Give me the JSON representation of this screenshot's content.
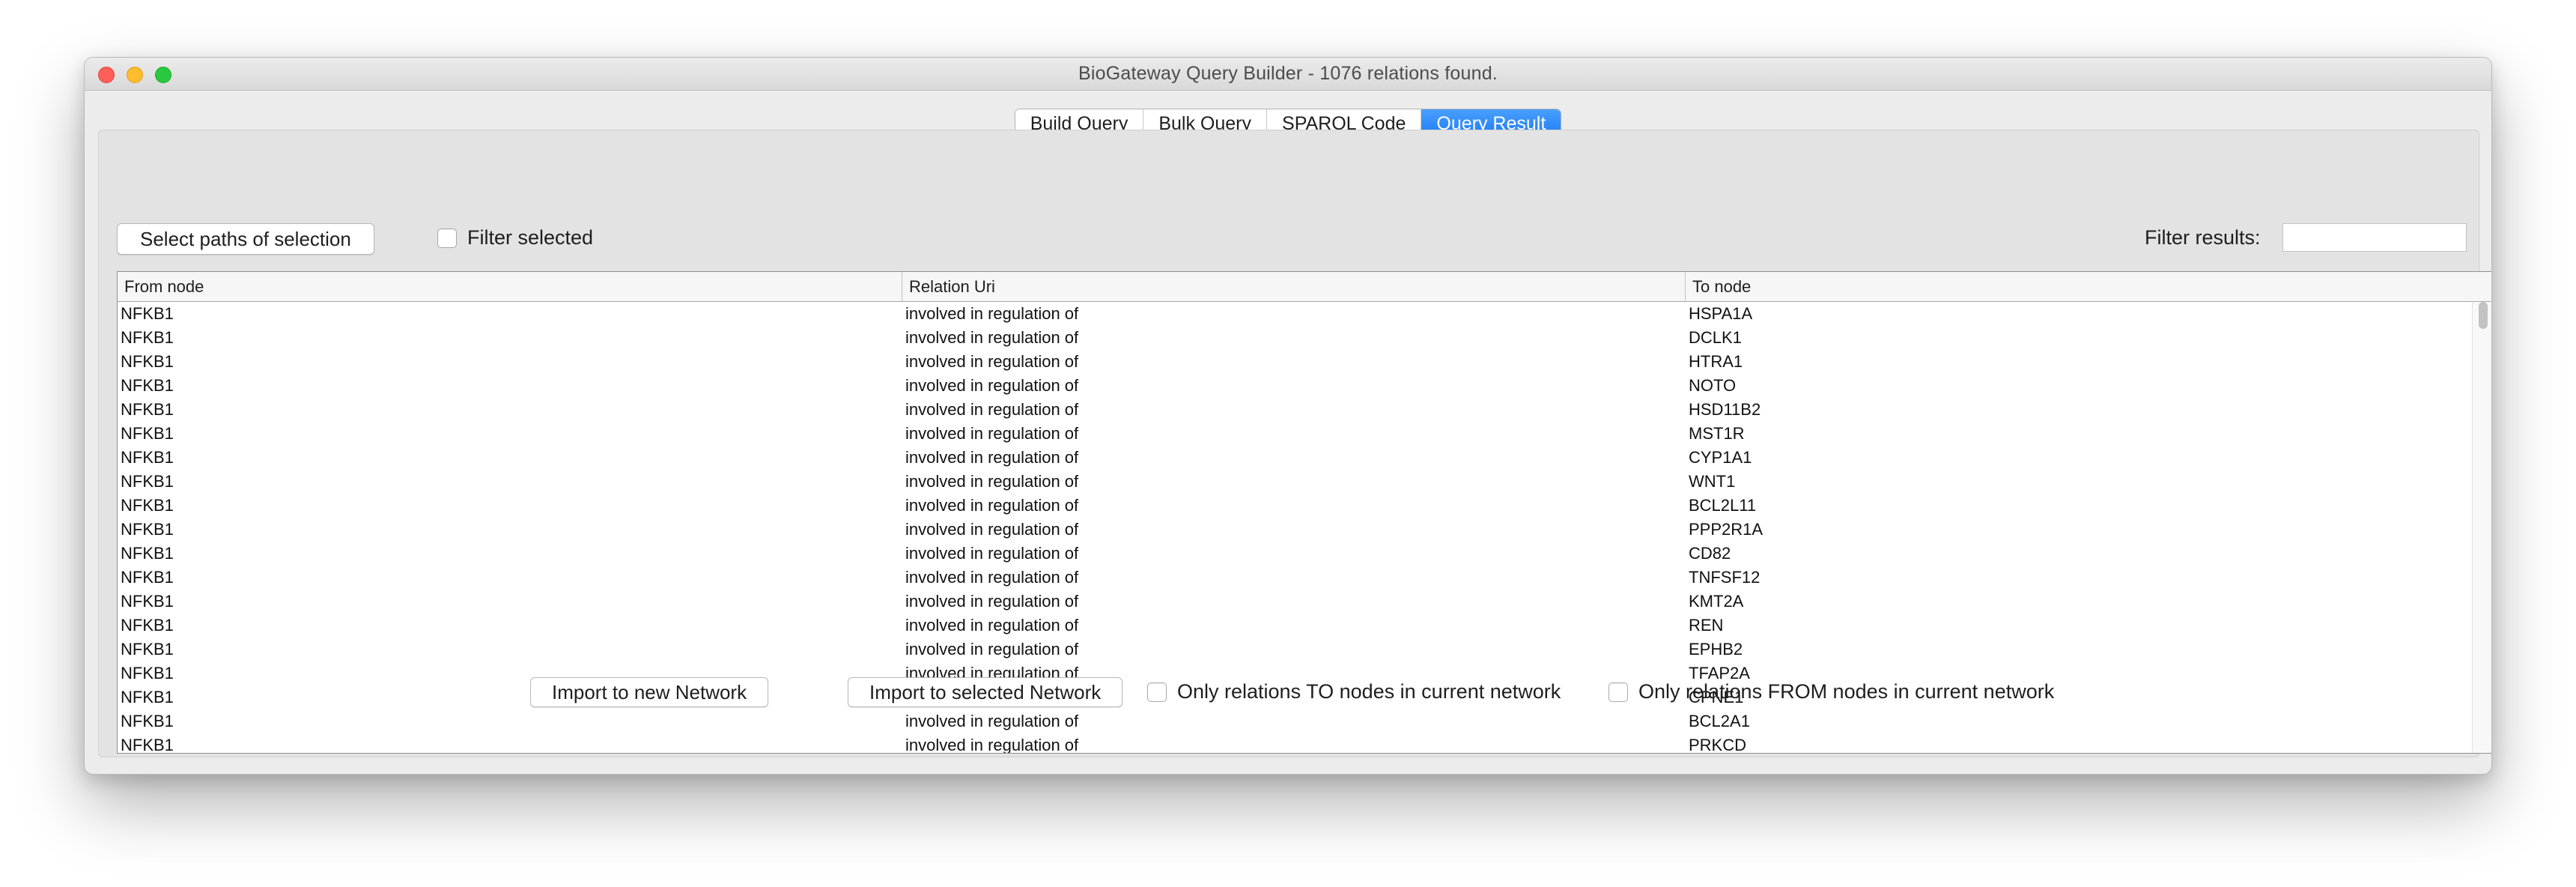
{
  "window": {
    "title": "BioGateway Query Builder - 1076 relations found."
  },
  "tabs": [
    {
      "label": "Build Query",
      "active": false
    },
    {
      "label": "Bulk Query",
      "active": false
    },
    {
      "label": "SPARQL Code",
      "active": false
    },
    {
      "label": "Query Result",
      "active": true
    }
  ],
  "toolbar": {
    "select_paths_label": "Select paths of selection",
    "filter_selected_label": "Filter selected",
    "filter_results_label": "Filter results:",
    "filter_results_value": ""
  },
  "table": {
    "columns": [
      "From node",
      "Relation Uri",
      "To node"
    ],
    "rows": [
      [
        "NFKB1",
        "involved in regulation of",
        "HSPA1A"
      ],
      [
        "NFKB1",
        "involved in regulation of",
        "DCLK1"
      ],
      [
        "NFKB1",
        "involved in regulation of",
        "HTRA1"
      ],
      [
        "NFKB1",
        "involved in regulation of",
        "NOTO"
      ],
      [
        "NFKB1",
        "involved in regulation of",
        "HSD11B2"
      ],
      [
        "NFKB1",
        "involved in regulation of",
        "MST1R"
      ],
      [
        "NFKB1",
        "involved in regulation of",
        "CYP1A1"
      ],
      [
        "NFKB1",
        "involved in regulation of",
        "WNT1"
      ],
      [
        "NFKB1",
        "involved in regulation of",
        "BCL2L11"
      ],
      [
        "NFKB1",
        "involved in regulation of",
        "PPP2R1A"
      ],
      [
        "NFKB1",
        "involved in regulation of",
        "CD82"
      ],
      [
        "NFKB1",
        "involved in regulation of",
        "TNFSF12"
      ],
      [
        "NFKB1",
        "involved in regulation of",
        "KMT2A"
      ],
      [
        "NFKB1",
        "involved in regulation of",
        "REN"
      ],
      [
        "NFKB1",
        "involved in regulation of",
        "EPHB2"
      ],
      [
        "NFKB1",
        "involved in regulation of",
        "TFAP2A"
      ],
      [
        "NFKB1",
        "involved in regulation of",
        "CPNE1"
      ],
      [
        "NFKB1",
        "involved in regulation of",
        "BCL2A1"
      ],
      [
        "NFKB1",
        "involved in regulation of",
        "PRKCD"
      ]
    ]
  },
  "footer": {
    "import_new_label": "Import to new Network",
    "import_selected_label": "Import to selected Network",
    "only_to_label": "Only relations TO nodes in current network",
    "only_from_label": "Only relations FROM nodes in current network"
  },
  "colors": {
    "accent": "#1b7af5",
    "window_bg": "#ececec",
    "panel_bg": "#e3e3e3"
  }
}
